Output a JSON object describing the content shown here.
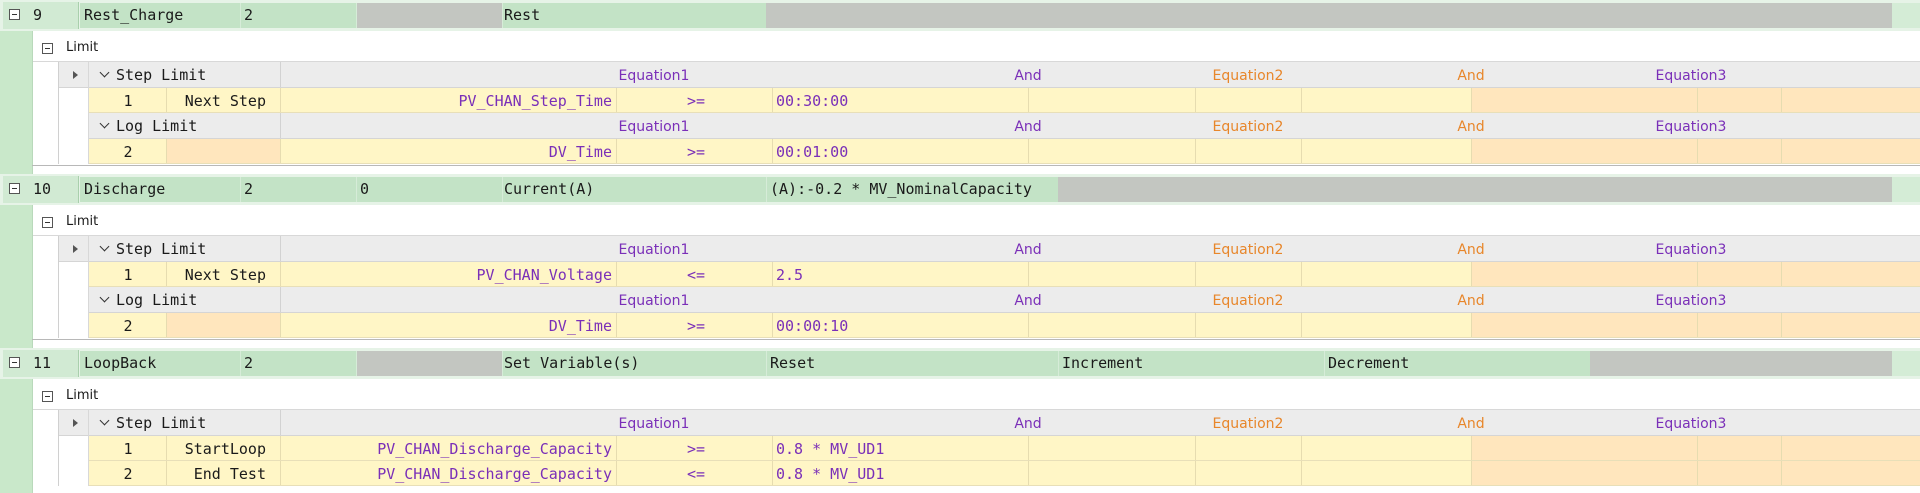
{
  "colors": {
    "step_row_bg": "#c3e3c6",
    "step_row_grey": "#c3c6c1",
    "left_strip": "#c9e8ca",
    "header_row_bg": "#ececec",
    "data_row_yellow": "#fff6c6",
    "data_row_orange": "#ffe6bd",
    "purple_label": "#7a2fb8",
    "orange_label": "#e8862a"
  },
  "limit_header": {
    "eq1": "Equation1",
    "and1": "And",
    "eq2": "Equation2",
    "and2": "And",
    "eq3": "Equation3"
  },
  "steps": [
    {
      "number": "9",
      "name": "Rest_Charge",
      "col3": "2",
      "col4": "",
      "col5": "Rest",
      "col6": "",
      "limit_title": "Limit",
      "groups": [
        {
          "label": "Step Limit",
          "rows": [
            {
              "num": "1",
              "goto": "Next Step",
              "var": "PV_CHAN_Step_Time",
              "op": ">=",
              "value": "00:30:00"
            }
          ]
        },
        {
          "label": "Log Limit",
          "rows": [
            {
              "num": "2",
              "goto": "",
              "var": "DV_Time",
              "op": ">=",
              "value": "00:01:00"
            }
          ]
        }
      ]
    },
    {
      "number": "10",
      "name": "Discharge",
      "col3": "2",
      "col4": "0",
      "col5": "Current(A)",
      "col6": "(A):-0.2 * MV_NominalCapacity",
      "limit_title": "Limit",
      "groups": [
        {
          "label": "Step Limit",
          "rows": [
            {
              "num": "1",
              "goto": "Next Step",
              "var": "PV_CHAN_Voltage",
              "op": "<=",
              "value": "2.5"
            }
          ]
        },
        {
          "label": "Log Limit",
          "rows": [
            {
              "num": "2",
              "goto": "",
              "var": "DV_Time",
              "op": ">=",
              "value": "00:00:10"
            }
          ]
        }
      ]
    },
    {
      "number": "11",
      "name": "LoopBack",
      "col3": "2",
      "col4": "",
      "col5": "Set Variable(s)",
      "col6": "Reset",
      "col7": "Increment",
      "col8": "Decrement",
      "limit_title": "Limit",
      "groups": [
        {
          "label": "Step Limit",
          "rows": [
            {
              "num": "1",
              "goto": "StartLoop",
              "var": "PV_CHAN_Discharge_Capacity",
              "op": ">=",
              "value": "0.8 * MV_UD1"
            },
            {
              "num": "2",
              "goto": "End Test",
              "var": "PV_CHAN_Discharge_Capacity",
              "op": "<=",
              "value": "0.8 * MV_UD1"
            }
          ]
        }
      ]
    }
  ]
}
